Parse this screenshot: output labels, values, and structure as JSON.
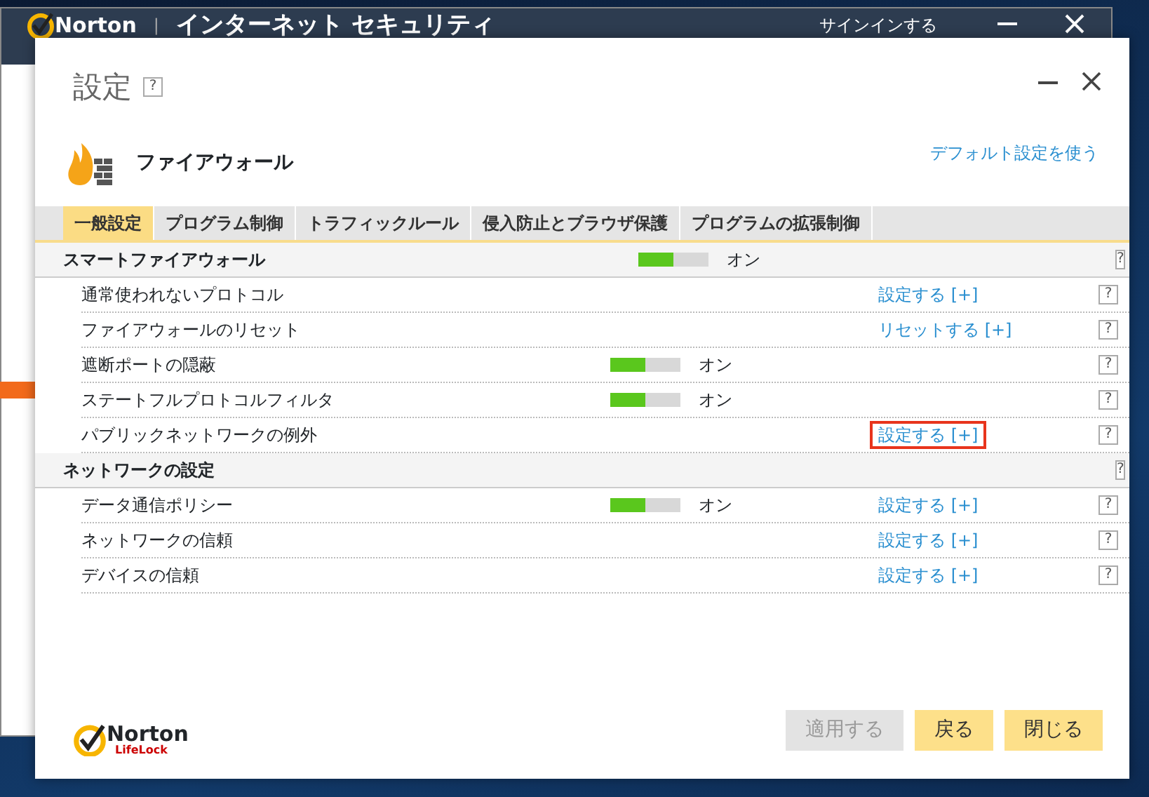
{
  "background_window": {
    "brand": "Norton",
    "separator": "|",
    "title": "インターネット セキュリティ",
    "sign_in": "サインインする"
  },
  "dialog": {
    "title": "設定",
    "help": "?",
    "feature": "ファイアウォール",
    "default_link": "デフォルト設定を使う",
    "tabs": [
      {
        "label": "一般設定",
        "selected": true
      },
      {
        "label": "プログラム制御",
        "selected": false
      },
      {
        "label": "トラフィックルール",
        "selected": false
      },
      {
        "label": "侵入防止とブラウザ保護",
        "selected": false
      },
      {
        "label": "プログラムの拡張制御",
        "selected": false
      }
    ],
    "sections": [
      {
        "title": "スマートファイアウォール",
        "on": true,
        "status": "オン",
        "help": "?",
        "rows": [
          {
            "label": "通常使われないプロトコル",
            "link": "設定する [+]",
            "highlighted": false,
            "help": "?"
          },
          {
            "label": "ファイアウォールのリセット",
            "link": "リセットする [+]",
            "highlighted": false,
            "help": "?"
          },
          {
            "label": "遮断ポートの隠蔽",
            "on": true,
            "status": "オン",
            "help": "?"
          },
          {
            "label": "ステートフルプロトコルフィルタ",
            "on": true,
            "status": "オン",
            "help": "?"
          },
          {
            "label": "パブリックネットワークの例外",
            "link": "設定する [+]",
            "highlighted": true,
            "help": "?"
          }
        ]
      },
      {
        "title": "ネットワークの設定",
        "help": "?",
        "rows": [
          {
            "label": "データ通信ポリシー",
            "on": true,
            "status": "オン",
            "link": "設定する [+]",
            "highlighted": false,
            "help": "?"
          },
          {
            "label": "ネットワークの信頼",
            "link": "設定する [+]",
            "highlighted": false,
            "help": "?"
          },
          {
            "label": "デバイスの信頼",
            "link": "設定する [+]",
            "highlighted": false,
            "help": "?"
          }
        ]
      }
    ],
    "logo": {
      "name": "Norton",
      "sub": "LifeLock"
    },
    "buttons": [
      {
        "label": "適用する",
        "disabled": true
      },
      {
        "label": "戻る",
        "disabled": false
      },
      {
        "label": "閉じる",
        "disabled": false
      }
    ]
  }
}
